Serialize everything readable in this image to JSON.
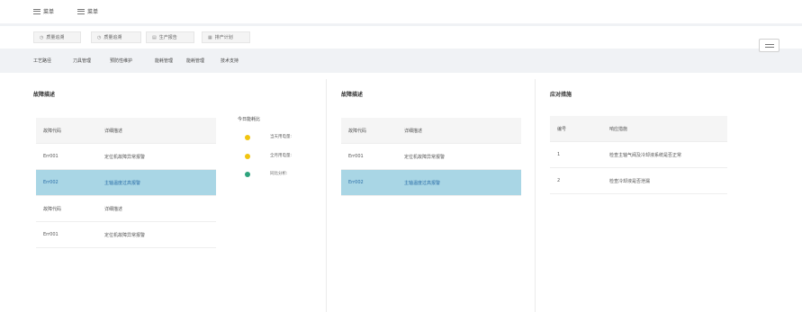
{
  "topbar": {
    "menus": [
      "菜单",
      "菜单"
    ]
  },
  "tabs": [
    {
      "icon": "clock-icon",
      "glyph": "◷",
      "label": "质量追溯"
    },
    {
      "icon": "clock-icon",
      "glyph": "◷",
      "label": "质量追溯"
    },
    {
      "icon": "document-icon",
      "glyph": "▤",
      "label": "生产报告"
    },
    {
      "icon": "grid-icon",
      "glyph": "▦",
      "label": "排产计划"
    }
  ],
  "subnav": [
    "工艺路径",
    "刀具管理",
    "预防性维护",
    "能耗管理",
    "能耗管理",
    "技术支持"
  ],
  "panel1": {
    "title": "故障描述",
    "table1": {
      "headers": [
        "故障代码",
        "详细描述"
      ],
      "rows": [
        [
          "Err001",
          "定位机故障异常报警"
        ],
        [
          "Err002",
          "主轴温度过高报警"
        ]
      ]
    },
    "table2": {
      "headers": [
        "故障代码",
        "详细描述"
      ],
      "rows": [
        [
          "Err001",
          "定位机故障异常报警"
        ]
      ]
    },
    "legend": {
      "title": "今日能耗比",
      "items": [
        {
          "label": "当天用电量:",
          "color": "#f1c40f"
        },
        {
          "label": "全月用电量:",
          "color": "#f1c40f"
        },
        {
          "label": "同比分析:",
          "color": "#2ea37d"
        }
      ]
    }
  },
  "panel2": {
    "title": "故障描述",
    "table": {
      "headers": [
        "故障代码",
        "详细描述"
      ],
      "rows": [
        [
          "Err001",
          "定位机故障异常报警"
        ],
        [
          "Err002",
          "主轴温度过高报警"
        ]
      ]
    }
  },
  "panel3": {
    "title": "应对措施",
    "table": {
      "headers": [
        "编号",
        "响应措施"
      ],
      "rows": [
        [
          "1",
          "检查主轴气阀及冷却液系统是否正常"
        ],
        [
          "2",
          "检查冷却液是否泄漏"
        ]
      ]
    }
  }
}
